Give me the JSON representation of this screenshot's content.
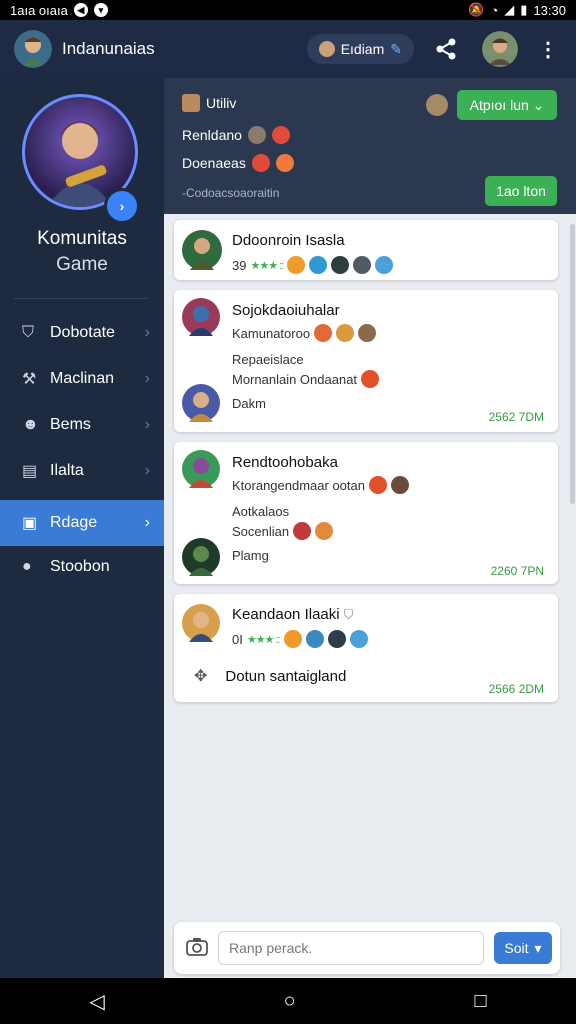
{
  "status_bar": {
    "left_text": "1aıa oıaıa",
    "time": "13:30"
  },
  "topbar": {
    "title": "Indanunaias",
    "pill_label": "Eıdiam"
  },
  "sidebar": {
    "title": "Komunitas",
    "subtitle": "Game",
    "items": [
      {
        "label": "Dobotate",
        "icon": "shield-icon"
      },
      {
        "label": "Maclinan",
        "icon": "hammer-icon"
      },
      {
        "label": "Bems",
        "icon": "user-icon"
      },
      {
        "label": "Ilalta",
        "icon": "list-icon"
      },
      {
        "label": "Rdage",
        "icon": "image-icon",
        "active": true
      },
      {
        "label": "Stoobon",
        "icon": "chat-icon"
      }
    ]
  },
  "header": {
    "top_label": "Utiliv",
    "button_top": "Atpıoı lun",
    "row1_label": "Renldano",
    "row2_label": "Doenaeas",
    "footer_label": "-Codoacsoaoraitin",
    "button_bottom": "1ao lton"
  },
  "posts": [
    {
      "title": "Ddoonroin Isasla",
      "meta": "39",
      "stars": "★★★ ::"
    },
    {
      "title": "Sojokdaoiuhalar",
      "line1": "Kamunatoroo",
      "line2": "Repaeislace",
      "line3": "Mornanlain Ondaanat",
      "author": "Dakm",
      "time": "2562 7DM"
    },
    {
      "title": "Rendtoohobaka",
      "line1": "Ktorangendmaar ootan",
      "line2": "Aotkalaos",
      "line3": "Socenlian",
      "author": "Plamg",
      "time": "2260 7PN"
    },
    {
      "title": "Keandaon Ilaaki",
      "meta": "0I",
      "stars": "★★★ ::",
      "body": "Dotun santaigland",
      "time": "2566 2DM"
    }
  ],
  "composer": {
    "placeholder": "Ranp perack.",
    "send_label": "Soit"
  },
  "colors": {
    "accent": "#3a7bd5",
    "green": "#3bb054",
    "sidebar": "#1e2a40",
    "header": "#2b3850"
  }
}
